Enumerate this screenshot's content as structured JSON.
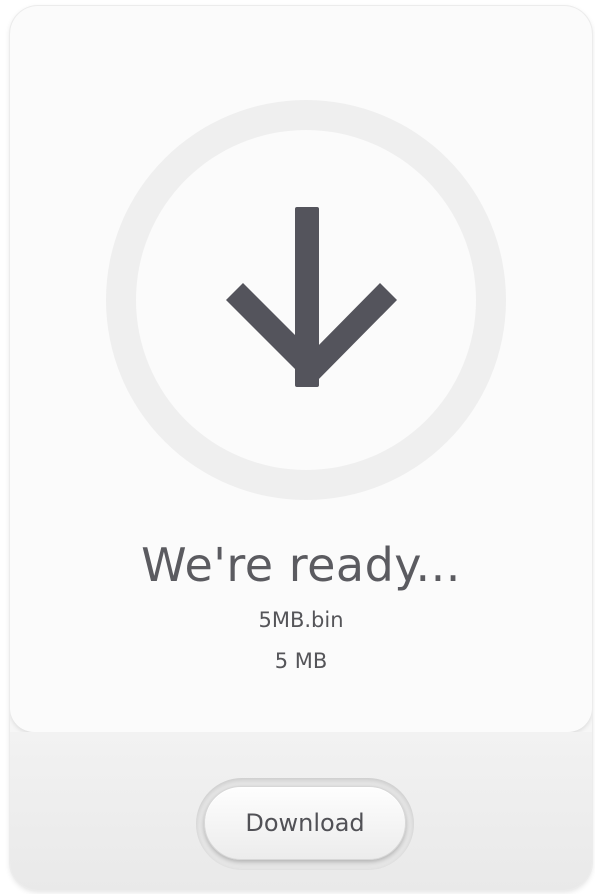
{
  "status": {
    "title": "We're ready...",
    "file_name": "5MB.bin",
    "file_size": "5 MB"
  },
  "actions": {
    "download_label": "Download"
  },
  "icons": {
    "main": "arrow-down-icon"
  },
  "colors": {
    "icon": "#54545c",
    "text": "#5b5b60",
    "ring": "#efefef",
    "card": "#fbfbfb"
  }
}
